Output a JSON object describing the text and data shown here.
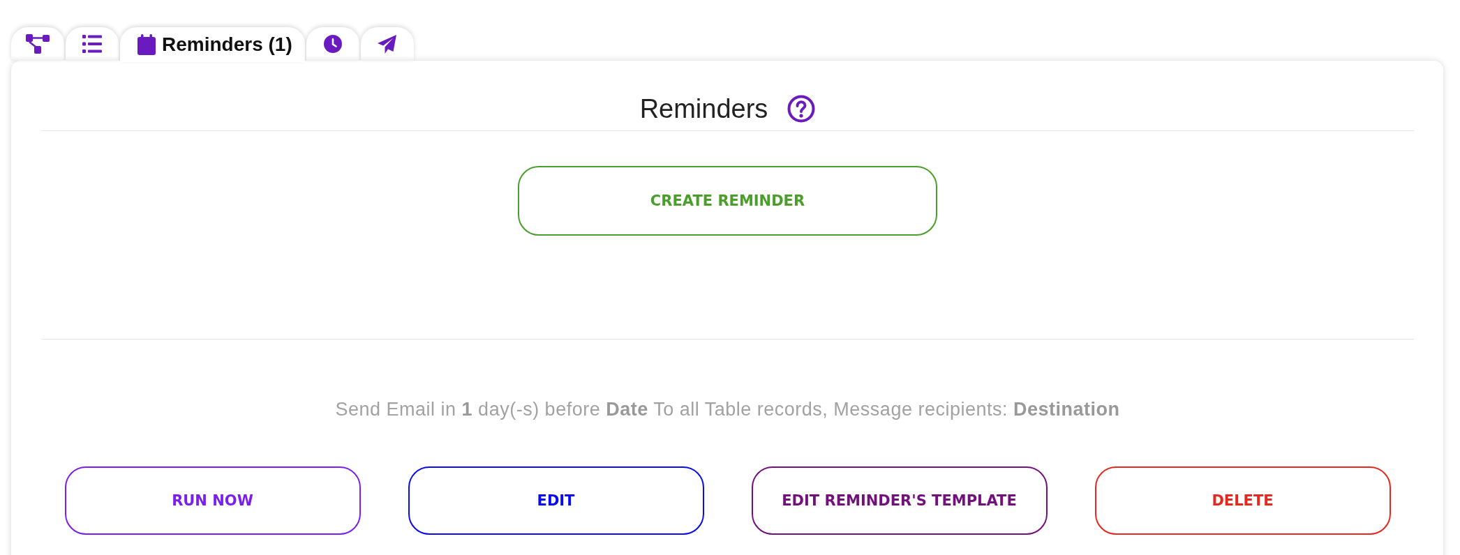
{
  "tabs": [
    {
      "kind": "hierarchy",
      "selected": false
    },
    {
      "kind": "list",
      "selected": false
    },
    {
      "kind": "calendar",
      "label": "Reminders (1)",
      "selected": true
    },
    {
      "kind": "clock",
      "selected": false
    },
    {
      "kind": "send",
      "selected": false
    }
  ],
  "panel": {
    "title": "Reminders",
    "create_button": "CREATE REMINDER",
    "reminder": {
      "summary": "Send Email in **1** day(-s) before **Date** To all Table records, Message recipients: **Destination**",
      "actions": [
        {
          "label": "RUN NOW",
          "color": "#7a1ff0"
        },
        {
          "label": "EDIT",
          "color": "#0b0bf0"
        },
        {
          "label": "EDIT REMINDER'S TEMPLATE",
          "color": "#74107e"
        },
        {
          "label": "DELETE",
          "color": "#e8281e"
        }
      ]
    }
  }
}
